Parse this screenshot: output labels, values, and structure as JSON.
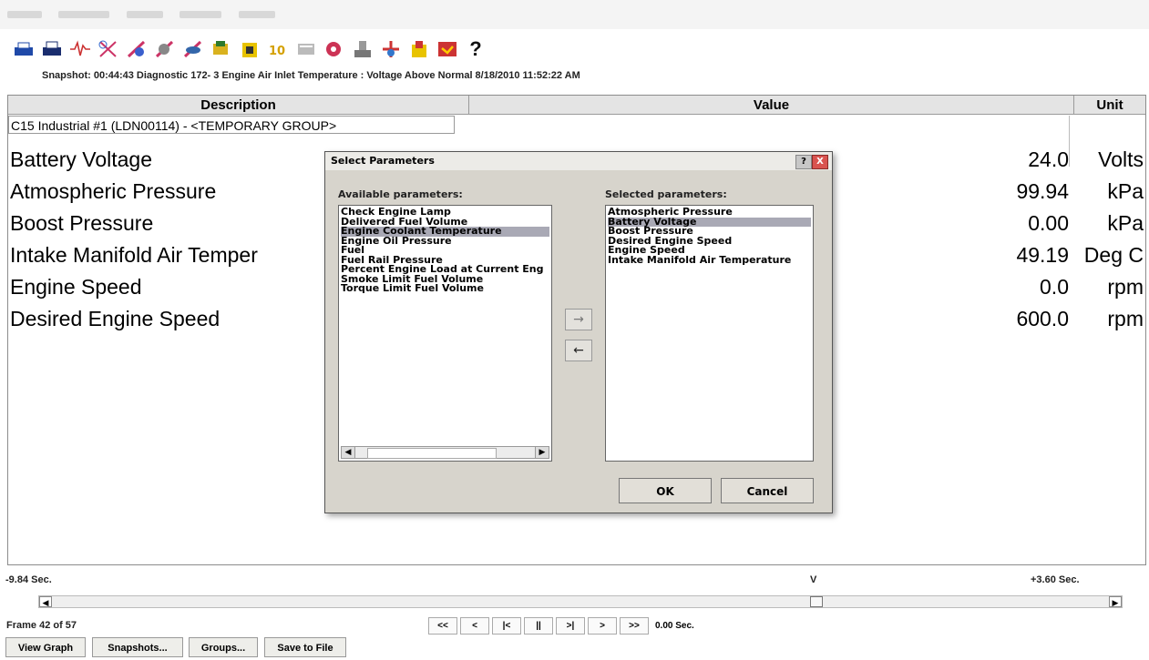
{
  "snapshot_info": "Snapshot: 00:44:43 Diagnostic   172- 3 Engine Air Inlet Temperature : Voltage Above Normal 8/18/2010 11:52:22 AM",
  "toolbar_icons": [
    "printer-icon",
    "print-preview-icon",
    "waveform-icon",
    "tool-a-icon",
    "tool-b-icon",
    "tool-c-icon",
    "tool-d-icon",
    "tool-e-icon",
    "tool-f-icon",
    "tool-g-icon",
    "tool-h-icon",
    "tool-i-icon",
    "tool-j-icon",
    "tool-k-icon",
    "tool-l-icon",
    "tool-m-icon",
    "help-icon"
  ],
  "help_glyph": "?",
  "columns": {
    "description": "Description",
    "value": "Value",
    "unit": "Unit"
  },
  "group_label": "C15 Industrial #1 (LDN00114) - <TEMPORARY GROUP>",
  "rows": [
    {
      "description": "Battery Voltage",
      "value": "24.0",
      "unit": "Volts"
    },
    {
      "description": "Atmospheric Pressure",
      "value": "99.94",
      "unit": "kPa"
    },
    {
      "description": "Boost Pressure",
      "value": "0.00",
      "unit": "kPa"
    },
    {
      "description": "Intake Manifold Air Temper",
      "value": "49.19",
      "unit": "Deg C"
    },
    {
      "description": "Engine Speed",
      "value": "0.0",
      "unit": "rpm"
    },
    {
      "description": "Desired Engine Speed",
      "value": "600.0",
      "unit": "rpm"
    }
  ],
  "dialog": {
    "title": "Select Parameters",
    "help": "?",
    "close": "X",
    "available_label": "Available parameters:",
    "selected_label": "Selected parameters:",
    "available": [
      "Check Engine Lamp",
      "Delivered Fuel Volume",
      "Engine Coolant Temperature",
      "Engine Oil Pressure",
      "Fuel",
      "Fuel Rail Pressure",
      "Percent Engine Load at Current Eng",
      "Smoke Limit Fuel Volume",
      "Torque Limit Fuel Volume"
    ],
    "available_selected": "Engine Coolant Temperature",
    "selected": [
      "Atmospheric Pressure",
      "Battery Voltage",
      "Boost Pressure",
      "Desired Engine Speed",
      "Engine Speed",
      "Intake Manifold Air Temperature"
    ],
    "selected_selected": "Battery Voltage",
    "add_arrow": "→",
    "remove_arrow": "←",
    "ok": "OK",
    "cancel": "Cancel"
  },
  "timeline": {
    "start": "-9.84 Sec.",
    "marker": "V",
    "end": "+3.60 Sec.",
    "frame": "Frame 42   of 57",
    "time": "0.00 Sec."
  },
  "nav_buttons": [
    "<<",
    "<",
    "|<",
    "||",
    ">|",
    ">",
    ">>"
  ],
  "bottom_buttons": [
    "View Graph",
    "Snapshots...",
    "Groups...",
    "Save to File"
  ]
}
